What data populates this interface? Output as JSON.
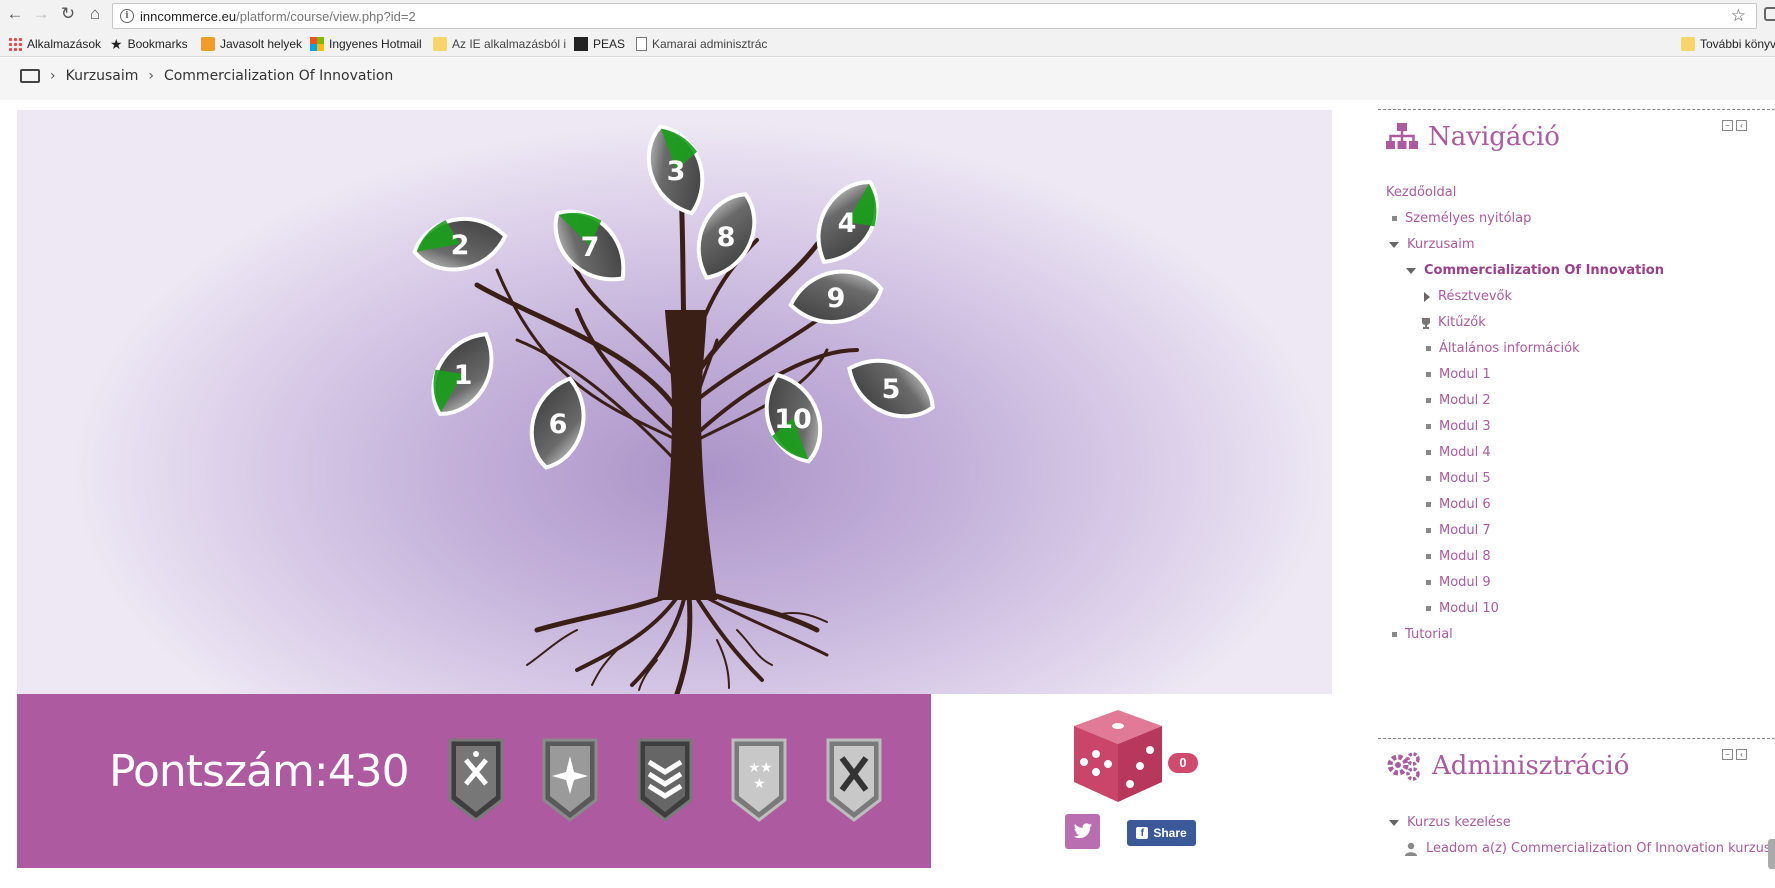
{
  "browser": {
    "url_host": "inncommerce.eu",
    "url_path": "/platform/course/view.php?id=2",
    "bookmarks": [
      {
        "label": "Alkalmazások",
        "icon": "apps-icon"
      },
      {
        "label": "Bookmarks",
        "icon": "star-icon"
      },
      {
        "label": "Javasolt helyek",
        "icon": "bulb-icon"
      },
      {
        "label": "Ingyenes Hotmail",
        "icon": "windows-icon"
      },
      {
        "label": "Az IE alkalmazásból i",
        "icon": "folder-icon"
      },
      {
        "label": "PEAS",
        "icon": "peas-icon"
      },
      {
        "label": "Kamarai adminisztrác",
        "icon": "doc-icon"
      },
      {
        "label": "További könyv",
        "icon": "folder-icon"
      }
    ]
  },
  "breadcrumb": {
    "items": [
      "Kurzusaim",
      "Commercialization Of Innovation"
    ],
    "separator": "›"
  },
  "tree": {
    "leaves": [
      "1",
      "2",
      "3",
      "4",
      "5",
      "6",
      "7",
      "8",
      "9",
      "10"
    ]
  },
  "score": {
    "label": "Pontszám:430"
  },
  "dice": {
    "count": "0"
  },
  "social": {
    "share_label": "Share",
    "facebook_letter": "f"
  },
  "navigation": {
    "title": "Navigáció",
    "home": "Kezdőoldal",
    "personal": "Személyes nyitólap",
    "my_courses": "Kurzusaim",
    "course": "Commercialization Of Innovation",
    "participants": "Résztvevők",
    "badges": "Kitűzők",
    "general": "Általános információk",
    "modules": [
      "Modul 1",
      "Modul 2",
      "Modul 3",
      "Modul 4",
      "Modul 5",
      "Modul 6",
      "Modul 7",
      "Modul 8",
      "Modul 9",
      "Modul 10"
    ],
    "tutorial": "Tutorial"
  },
  "administration": {
    "title": "Adminisztráció",
    "course_admin": "Kurzus kezelése",
    "unenrol": "Leadom a(z) Commercialization Of Innovation kurzust"
  },
  "colors": {
    "accent": "#ad5aa0",
    "leaf_dark": "#4a4a4a",
    "leaf_progress": "#18a018",
    "trunk": "#3a1f17",
    "dice": "#d04a6e",
    "facebook": "#3b5998"
  }
}
